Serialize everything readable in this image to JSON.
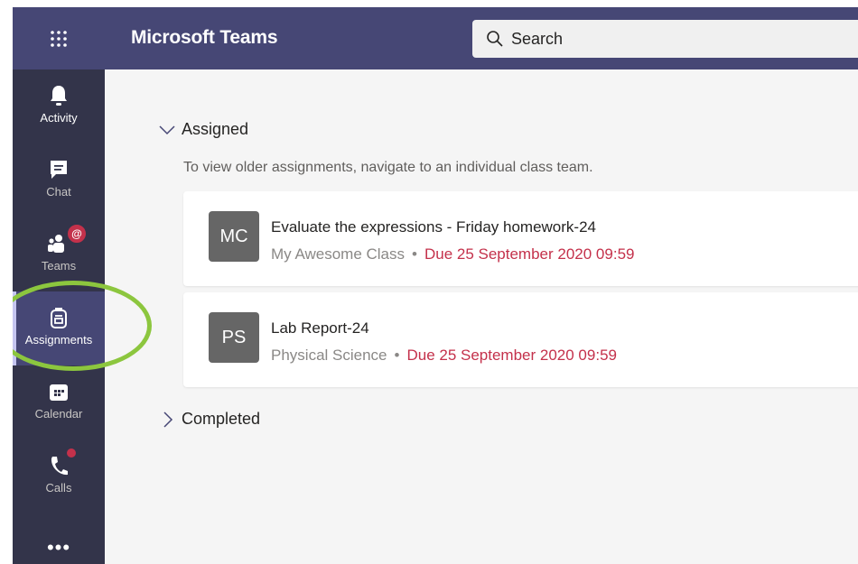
{
  "header": {
    "app_title": "Microsoft Teams",
    "waffle_icon": "app-launcher-icon",
    "search": {
      "placeholder": "Search",
      "icon": "search-icon"
    }
  },
  "rail": {
    "items": [
      {
        "label": "Activity",
        "icon": "bell-icon"
      },
      {
        "label": "Chat",
        "icon": "chat-icon"
      },
      {
        "label": "Teams",
        "icon": "teams-icon",
        "badge": "@"
      },
      {
        "label": "Assignments",
        "icon": "backpack-icon",
        "selected": true
      },
      {
        "label": "Calendar",
        "icon": "calendar-icon"
      },
      {
        "label": "Calls",
        "icon": "phone-icon",
        "dot": true
      }
    ],
    "more": "•••"
  },
  "main": {
    "assigned": {
      "label": "Assigned",
      "hint": "To view older assignments, navigate to an individual class team.",
      "cards": [
        {
          "initials": "MC",
          "title": "Evaluate the expressions - Friday homework-24",
          "class": "My Awesome Class",
          "separator": "•",
          "due": "Due 25 September 2020 09:59"
        },
        {
          "initials": "PS",
          "title": "Lab Report-24",
          "class": "Physical Science",
          "separator": "•",
          "due": "Due 25 September 2020 09:59"
        }
      ]
    },
    "completed": {
      "label": "Completed"
    }
  },
  "colors": {
    "topbar": "#464775",
    "rail": "#33344a",
    "due": "#c4314b",
    "highlight": "#8cc63e",
    "badge": "#c4314b"
  }
}
